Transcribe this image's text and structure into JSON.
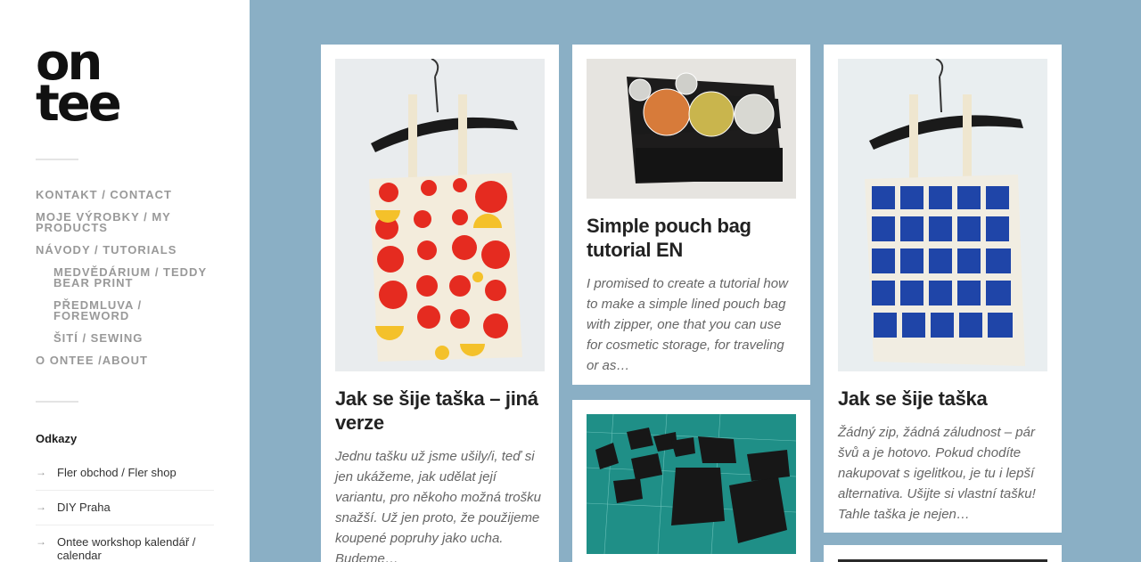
{
  "logo": {
    "line1": "on",
    "line2": "tee"
  },
  "menu": [
    {
      "label": "KONTAKT / CONTACT"
    },
    {
      "label": "MOJE VÝROBKY / MY PRODUCTS"
    },
    {
      "label": "NÁVODY / TUTORIALS"
    },
    {
      "label": "MEDVĚDÁRIUM / TEDDY BEAR PRINT"
    },
    {
      "label": "PŘEDMLUVA / FOREWORD"
    },
    {
      "label": "ŠITÍ / SEWING"
    },
    {
      "label": "O ONTEE /ABOUT"
    }
  ],
  "widget": {
    "title": "Odkazy",
    "links": [
      {
        "label": "Fler obchod / Fler shop"
      },
      {
        "label": "DIY Praha"
      },
      {
        "label": "Ontee workshop kalendář / calendar"
      }
    ]
  },
  "posts": [
    {
      "title": "Jak se šije taška – jiná verze",
      "excerpt": "Jednu tašku už jsme ušily/i, teď si jen ukážeme, jak udělat její variantu, pro někoho možná trošku snažší. Už jen proto, že použijeme koupené popruhy jako ucha. Budeme…"
    },
    {
      "title": "Simple pouch bag tutorial EN",
      "excerpt": "I promised to create a tutorial how to make a simple lined pouch bag with zipper, one that you can use for cosmetic storage, for traveling or as…"
    },
    {
      "title": "Jak se šije taška",
      "excerpt": "Žádný zip, žádná záludnost – pár švů a je hotovo. Pokud chodíte nakupovat s igelitkou, je tu i lepší alternativa. Ušijte si vlastní tašku! Tahle taška je nejen…"
    }
  ],
  "colors": {
    "background": "#8aafc5",
    "sidebar": "#ffffff",
    "menu_text": "#999999"
  }
}
